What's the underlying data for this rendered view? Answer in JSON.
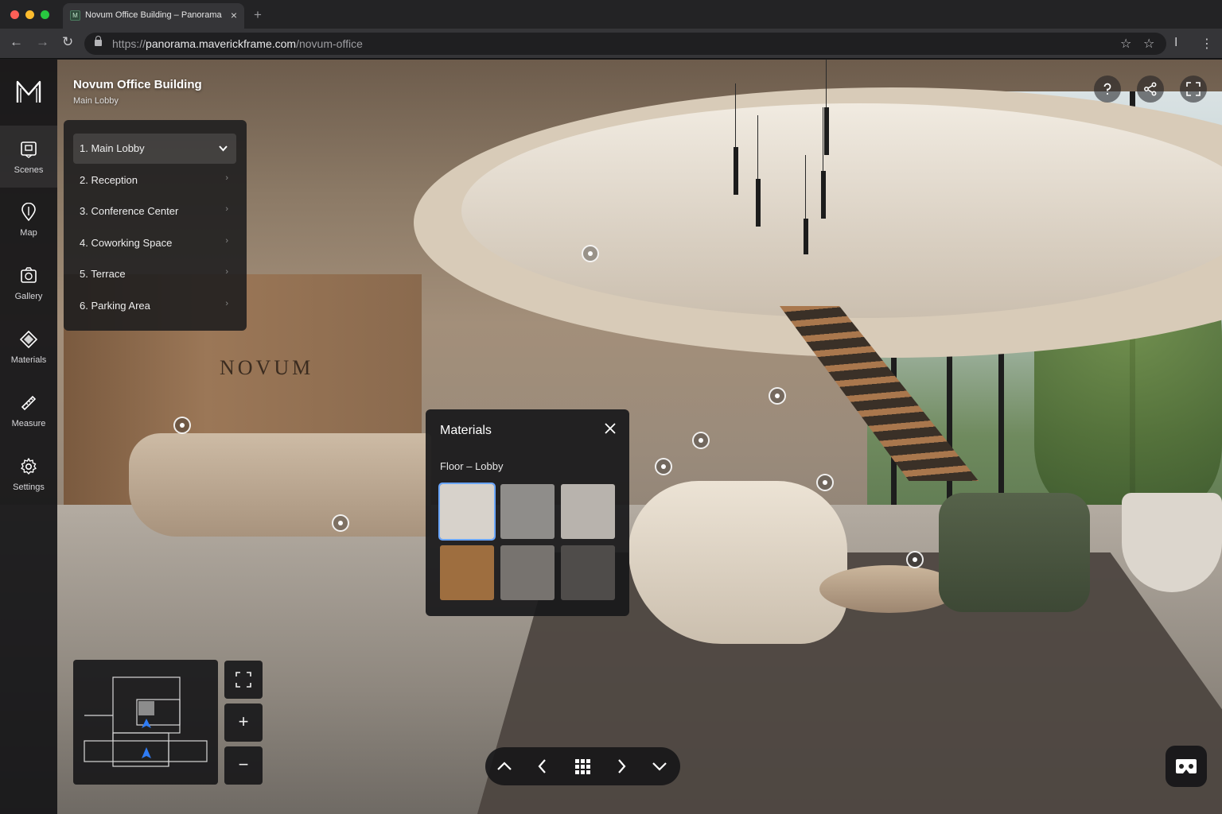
{
  "browser": {
    "tab_title": "Novum Office Building – Panorama",
    "tab_favicon": "M",
    "url_prefix": "https://",
    "url_host": "panorama.maverickframe.com",
    "url_path": "/novum-office"
  },
  "scene_photo": {
    "sign_text": "NOVUM"
  },
  "header": {
    "title": "Novum Office Building",
    "subtitle": "Main Lobby"
  },
  "rail": {
    "items": [
      {
        "label": "Scenes",
        "icon": "scenes-icon",
        "active": true
      },
      {
        "label": "Map",
        "icon": "map-pin-icon"
      },
      {
        "label": "Gallery",
        "icon": "gallery-icon"
      },
      {
        "label": "Materials",
        "icon": "materials-icon"
      },
      {
        "label": "Measure",
        "icon": "ruler-icon"
      },
      {
        "label": "Settings",
        "icon": "gear-icon"
      }
    ]
  },
  "scenes": [
    {
      "label": "1. Main Lobby",
      "selected": true
    },
    {
      "label": "2. Reception"
    },
    {
      "label": "3. Conference Center"
    },
    {
      "label": "4. Coworking Space"
    },
    {
      "label": "5. Terrace"
    },
    {
      "label": "6. Parking Area"
    }
  ],
  "materials": {
    "title": "Materials",
    "subtitle": "Floor – Lobby",
    "swatches": [
      {
        "color": "#d7d2cb",
        "selected": true
      },
      {
        "color": "#8f8d8a"
      },
      {
        "color": "#b8b3ad"
      },
      {
        "color": "#9e6e3f"
      },
      {
        "color": "#77736f"
      },
      {
        "color": "#4f4c4a"
      }
    ]
  },
  "colors": {
    "accent": "#6aa6ff",
    "map_marker": "#2f7cf6"
  }
}
